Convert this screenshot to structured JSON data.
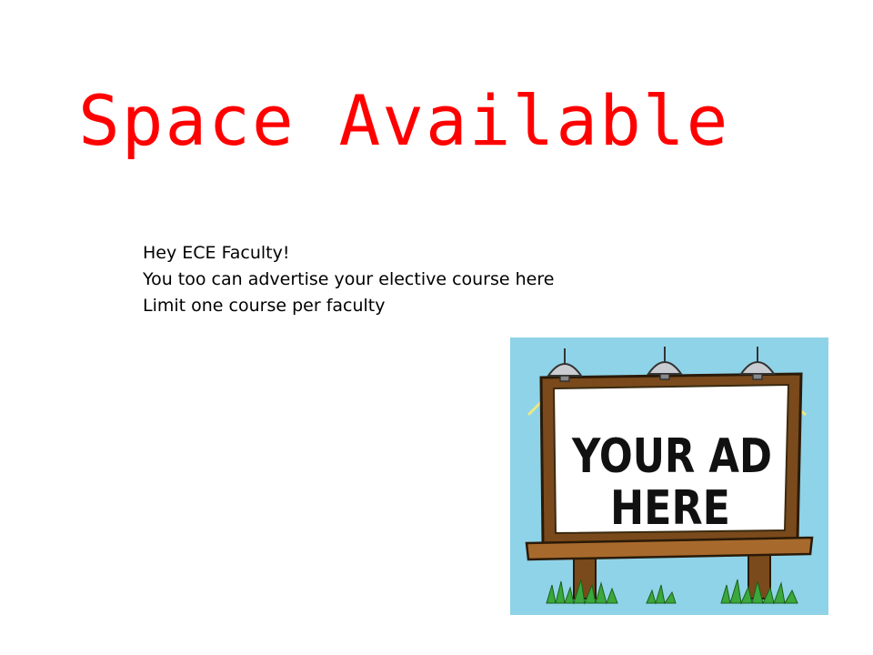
{
  "slide": {
    "title": "Space Available",
    "title_color": "#ff0000",
    "lines": [
      "Hey ECE Faculty!",
      "You too can advertise your elective course here",
      "Limit one course per faculty"
    ]
  },
  "billboard": {
    "line1": "YOUR AD",
    "line2": "HERE",
    "sky_color": "#8fd3e8",
    "frame_color": "#7a4a1c",
    "grass_color": "#3aa83a"
  }
}
